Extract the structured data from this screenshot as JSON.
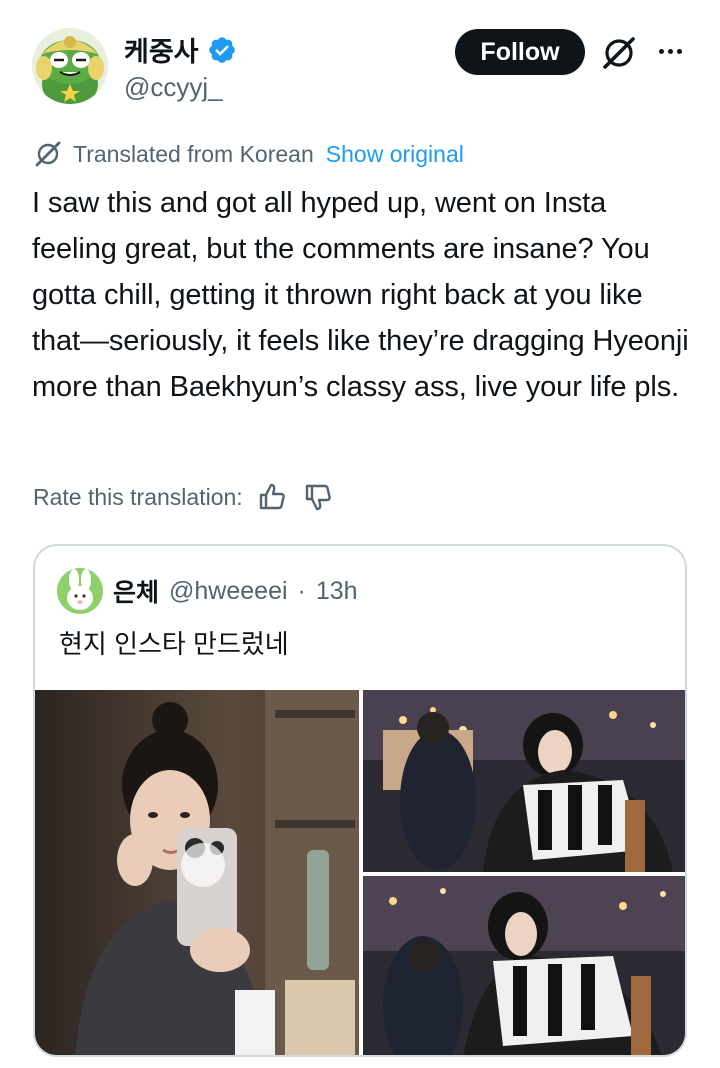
{
  "author": {
    "display_name": "케중사",
    "handle": "@ccyyj_",
    "verified": true,
    "avatar_icon": "frog-soldier-avatar"
  },
  "actions": {
    "follow_label": "Follow",
    "grok_icon": "grok-icon",
    "more_icon": "more-icon"
  },
  "translation": {
    "label": "Translated from Korean",
    "show_original": "Show original",
    "rate_label": "Rate this translation:"
  },
  "post": {
    "text": "I saw this and got all hyped up, went on Insta feeling great, but the comments are insane? You gotta chill, getting it thrown right back at you like that—seriously, it feels like they’re dragging Hyeonji more than Baekhyun’s classy ass, live your life pls."
  },
  "quote": {
    "display_name": "은체",
    "handle": "@hweeeei",
    "separator": "·",
    "time": "13h",
    "text": "현지 인스타 만드렀네",
    "avatar_icon": "bunny-avatar"
  },
  "colors": {
    "text": "#0f1419",
    "secondary": "#536471",
    "link": "#1d9bf0",
    "border": "#cfd9de",
    "verified": "#1d9bf0"
  }
}
